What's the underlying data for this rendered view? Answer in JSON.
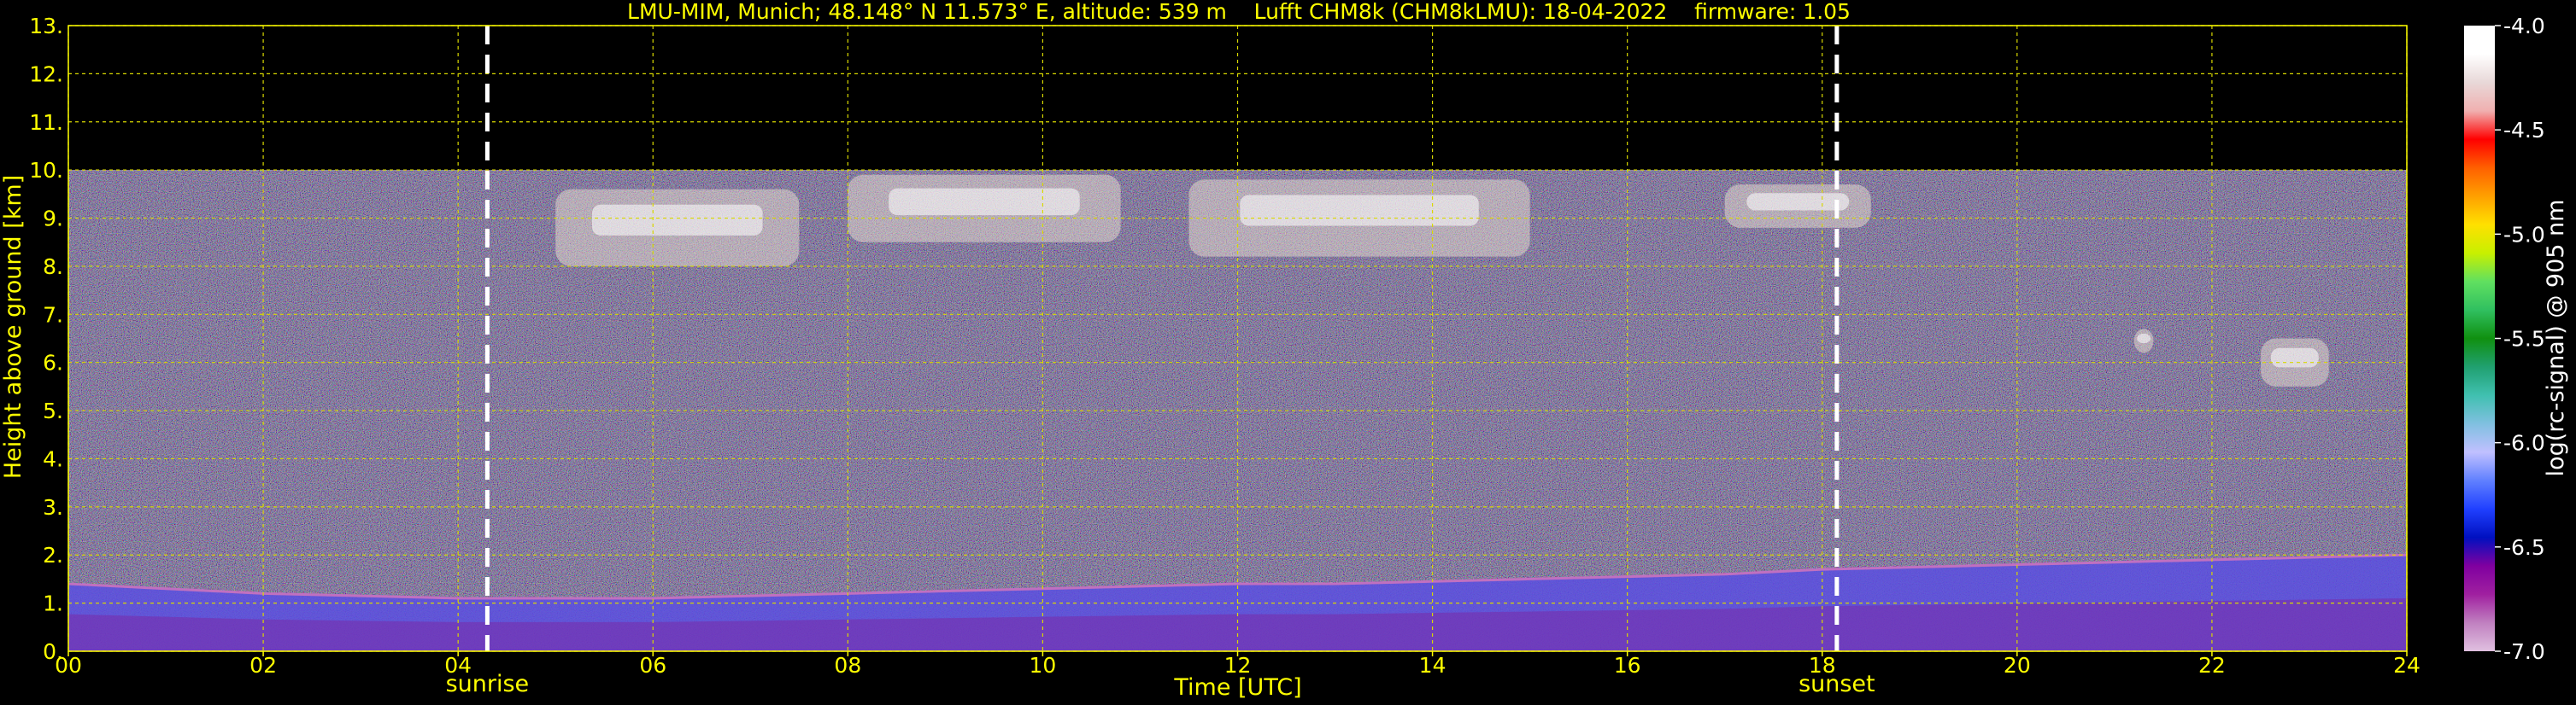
{
  "chart_data": {
    "type": "heatmap",
    "title": "LMU-MIM, Munich; 48.148° N 11.573° E, altitude: 539 m    Lufft CHM8k (CHM8kLMU): 18-04-2022    firmware: 1.05",
    "xlabel": "Time [UTC]",
    "ylabel": "Height above ground [km]",
    "xlim": [
      0,
      24
    ],
    "ylim": [
      0,
      13
    ],
    "x_ticks": [
      "00",
      "02",
      "04",
      "06",
      "08",
      "10",
      "12",
      "14",
      "16",
      "18",
      "20",
      "22",
      "24"
    ],
    "y_ticks": [
      "0.",
      "1.",
      "2.",
      "3.",
      "4.",
      "5.",
      "6.",
      "7.",
      "8.",
      "9.",
      "10.",
      "11.",
      "12.",
      "13."
    ],
    "grid": true,
    "data_top_km": 10,
    "sunrise": {
      "label": "sunrise",
      "time_utc": 4.3
    },
    "sunset": {
      "label": "sunset",
      "time_utc": 18.15
    },
    "colorbar": {
      "label": "log(rc-signal) @ 905 nm",
      "range": [
        -7.0,
        -4.0
      ],
      "ticks": [
        "-4.0",
        "-4.5",
        "-5.0",
        "-5.5",
        "-6.0",
        "-6.5",
        "-7.0"
      ]
    },
    "boundary_layer_km": {
      "x": [
        0,
        1,
        2,
        3,
        4,
        5,
        6,
        7,
        8,
        9,
        10,
        11,
        12,
        13,
        14,
        15,
        16,
        17,
        18,
        19,
        20,
        21,
        22,
        23,
        24
      ],
      "top": [
        1.4,
        1.3,
        1.2,
        1.15,
        1.1,
        1.1,
        1.1,
        1.15,
        1.2,
        1.25,
        1.3,
        1.35,
        1.4,
        1.4,
        1.45,
        1.5,
        1.55,
        1.6,
        1.7,
        1.75,
        1.8,
        1.85,
        1.9,
        1.95,
        2.0
      ]
    },
    "cirrus_clouds": [
      {
        "start": 5.0,
        "end": 7.5,
        "base_km": 8.0,
        "top_km": 9.6
      },
      {
        "start": 8.0,
        "end": 10.8,
        "base_km": 8.5,
        "top_km": 9.9
      },
      {
        "start": 11.5,
        "end": 15.0,
        "base_km": 8.2,
        "top_km": 9.8
      },
      {
        "start": 17.0,
        "end": 18.5,
        "base_km": 8.8,
        "top_km": 9.7
      },
      {
        "start": 21.2,
        "end": 21.4,
        "base_km": 6.2,
        "top_km": 6.7
      },
      {
        "start": 22.5,
        "end": 23.2,
        "base_km": 5.5,
        "top_km": 6.5
      }
    ]
  },
  "colors": {
    "text": "#ffff00",
    "grid": "#d8d800",
    "background": "#000000",
    "sun_lines": "#ffffff",
    "colorbar_stops": [
      "#ffffff",
      "#ffffff",
      "#e8d8d8",
      "#f0b0b0",
      "#ff0000",
      "#ff6000",
      "#ffa000",
      "#ffe000",
      "#c8f000",
      "#60e060",
      "#30c060",
      "#109010",
      "#20a070",
      "#40c0b0",
      "#80c0e0",
      "#c0c0ff",
      "#6080ff",
      "#2040ff",
      "#0010c0",
      "#8000a0",
      "#a020a0",
      "#c080c0",
      "#e0c0e0"
    ]
  }
}
